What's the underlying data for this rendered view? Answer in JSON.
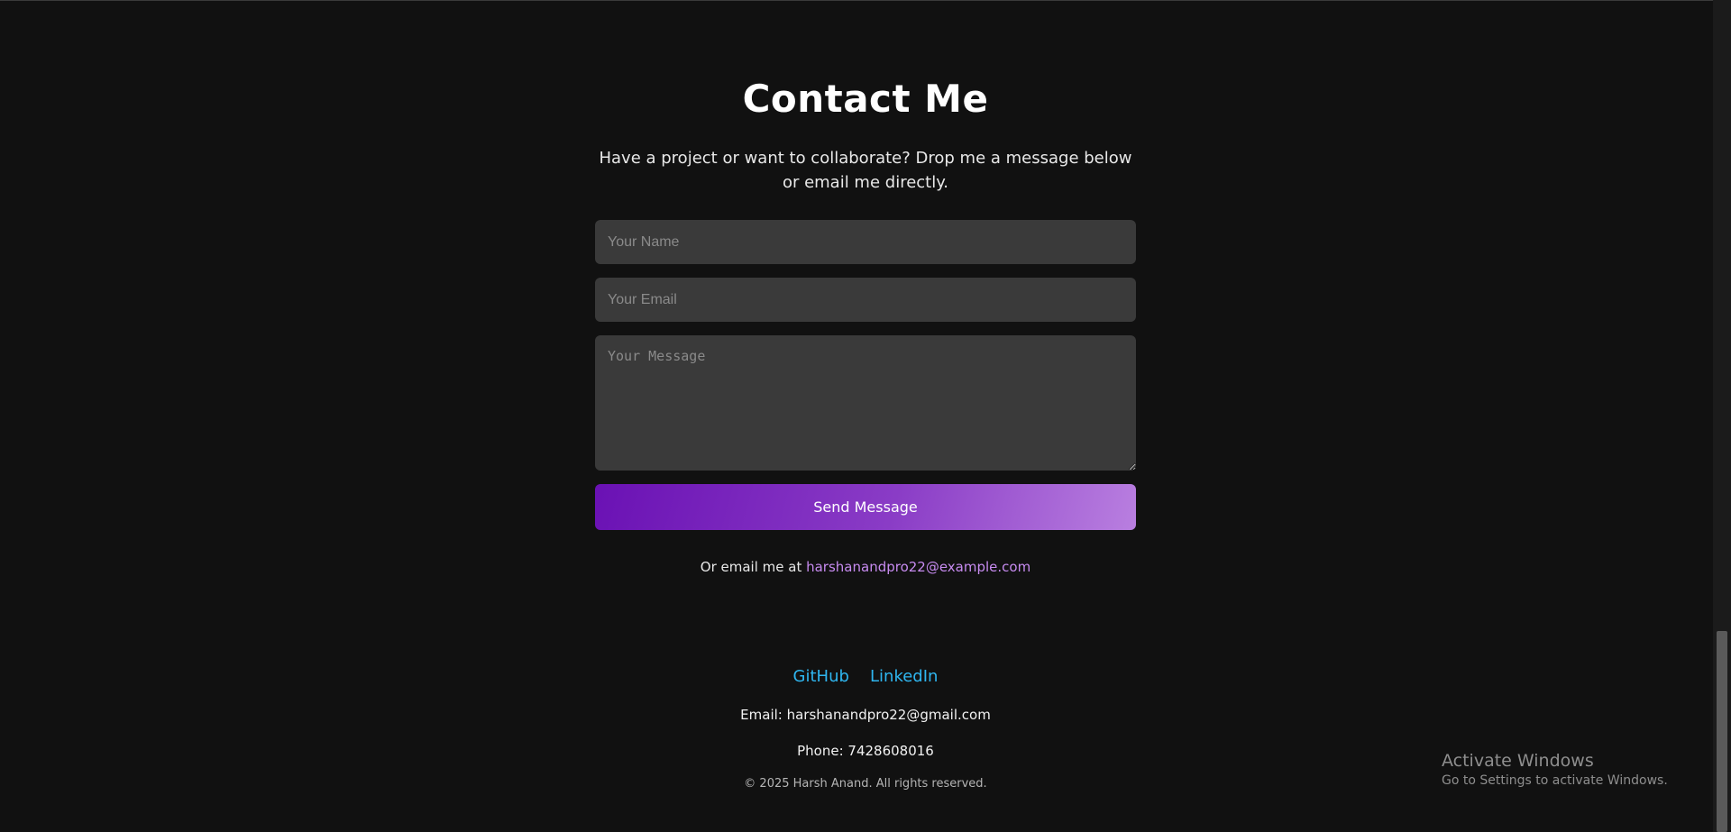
{
  "contact": {
    "title": "Contact Me",
    "subtitle": "Have a project or want to collaborate? Drop me a message below or email me directly."
  },
  "form": {
    "name_placeholder": "Your Name",
    "email_placeholder": "Your Email",
    "message_placeholder": "Your Message",
    "send_label": "Send Message"
  },
  "or_email": {
    "prefix": "Or email me at ",
    "address": "harshanandpro22@example.com"
  },
  "footer": {
    "links": [
      "GitHub",
      "LinkedIn"
    ],
    "email_line": "Email: harshanandpro22@gmail.com",
    "phone_line": "Phone: 7428608016",
    "copyright": "© 2025 Harsh Anand. All rights reserved."
  },
  "watermark": {
    "title": "Activate Windows",
    "subtitle": "Go to Settings to activate Windows."
  },
  "colors": {
    "background": "#111111",
    "field_bg": "#3a3a3a",
    "button_gradient_start": "#6a11b4",
    "button_gradient_end": "#b97fe0",
    "email_link": "#c78bf0",
    "social_link": "#2fb6f0"
  }
}
